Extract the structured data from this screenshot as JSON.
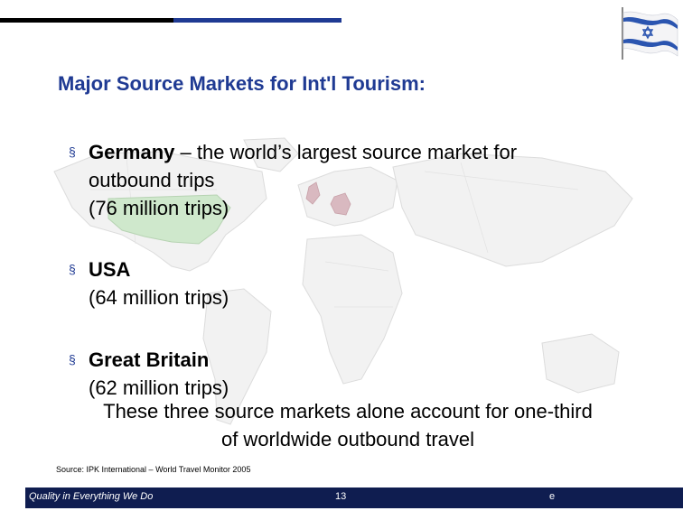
{
  "title": "Major Source Markets for Int'l Tourism:",
  "bullets": [
    {
      "bold": "Germany",
      "rest": " – the world’s largest source market for",
      "line2": "outbound trips",
      "line3": "(76 million trips)"
    },
    {
      "bold": "USA",
      "line2": "(64 million trips)"
    },
    {
      "bold": "Great Britain",
      "line2": "(62 million trips)"
    }
  ],
  "bullet_marker": "§",
  "summary": {
    "line1": "These three source markets alone account for one-third",
    "line2": "of worldwide outbound travel"
  },
  "source": "Source: IPK International – World Travel Monitor 2005",
  "footer": {
    "motto": "Quality in Everything We Do",
    "page_number": "13",
    "extra": "e"
  },
  "colors": {
    "title": "#1f3a93",
    "footer_bg": "#0f1d50",
    "highlight_countries": "#d9b9c0",
    "usa_fill": "#cfe8cc"
  }
}
